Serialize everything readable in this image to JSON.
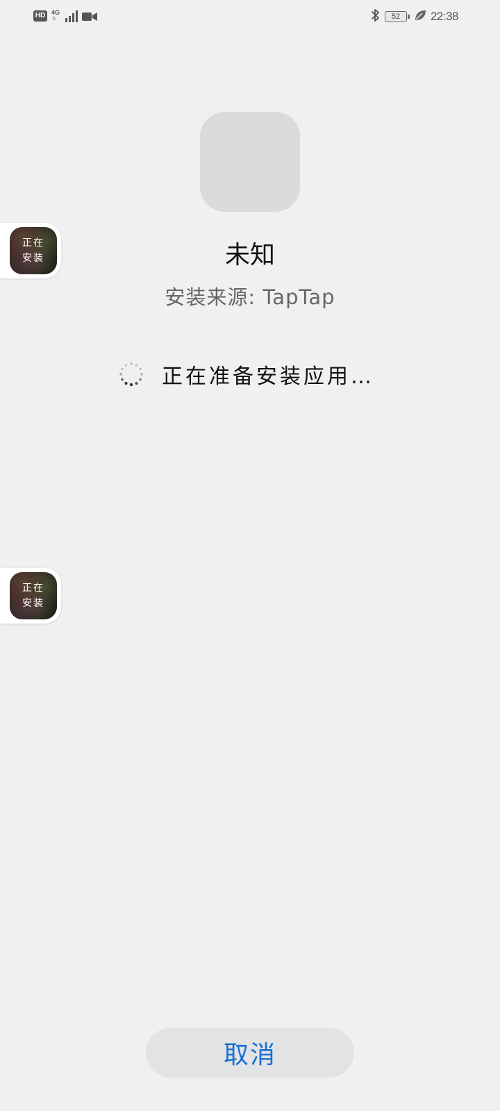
{
  "status_bar": {
    "hd": "HD",
    "network_type": "4G",
    "network_arrows": "⇅",
    "battery_level": "52",
    "time": "22:38"
  },
  "app": {
    "name": "未知",
    "install_source": "安装来源: TapTap"
  },
  "status": {
    "text": "正在准备安装应用…"
  },
  "floating_bubbles": [
    {
      "line1": "正在",
      "line2": "安装"
    },
    {
      "line1": "正在",
      "line2": "安装"
    }
  ],
  "buttons": {
    "cancel_label": "取消"
  },
  "colors": {
    "background": "#eff0f2",
    "accent": "#1a6fd1",
    "button_bg": "#e2e3e5",
    "icon_placeholder": "#d9dadc"
  }
}
